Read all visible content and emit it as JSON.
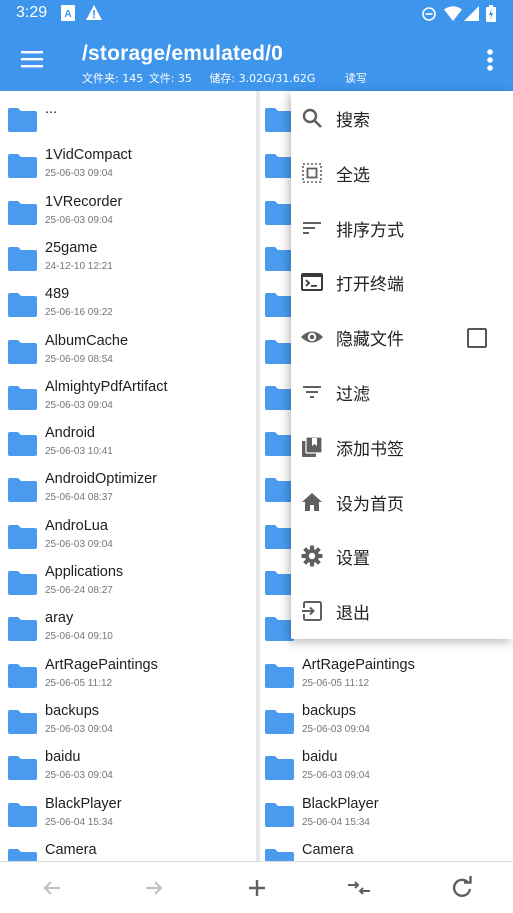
{
  "colors": {
    "primary": "#3d95ec",
    "folder": "#4a9bf0",
    "icon_gray": "#5f5f5f"
  },
  "status_bar": {
    "time": "3:29"
  },
  "toolbar": {
    "title": "/storage/emulated/0",
    "folders": "文件夹: 145",
    "files": "文件: 35",
    "storage": "储存: 3.02G/31.62G",
    "mode": "读写",
    "menu_icon": "hamburger-icon",
    "overflow_icon": "more-vert-icon"
  },
  "left_pane": [
    {
      "name": "...",
      "date": ""
    },
    {
      "name": "1VidCompact",
      "date": "25-06-03 09:04"
    },
    {
      "name": "1VRecorder",
      "date": "25-06-03 09:04"
    },
    {
      "name": "25game",
      "date": "24-12-10 12:21"
    },
    {
      "name": "489",
      "date": "25-06-16 09:22"
    },
    {
      "name": "AlbumCache",
      "date": "25-06-09 08:54"
    },
    {
      "name": "AlmightyPdfArtifact",
      "date": "25-06-03 09:04"
    },
    {
      "name": "Android",
      "date": "25-06-03 10:41"
    },
    {
      "name": "AndroidOptimizer",
      "date": "25-06-04 08:37"
    },
    {
      "name": "AndroLua",
      "date": "25-06-03 09:04"
    },
    {
      "name": "Applications",
      "date": "25-06-24 08:27"
    },
    {
      "name": "aray",
      "date": "25-06-04 09:10"
    },
    {
      "name": "ArtRagePaintings",
      "date": "25-06-05 11:12"
    },
    {
      "name": "backups",
      "date": "25-06-03 09:04"
    },
    {
      "name": "baidu",
      "date": "25-06-03 09:04"
    },
    {
      "name": "BlackPlayer",
      "date": "25-06-04 15:34"
    },
    {
      "name": "Camera",
      "date": ""
    }
  ],
  "right_pane": [
    {
      "name": "ArtRagePaintings",
      "date": "25-06-05 11:12"
    },
    {
      "name": "backups",
      "date": "25-06-03 09:04"
    },
    {
      "name": "baidu",
      "date": "25-06-03 09:04"
    },
    {
      "name": "BlackPlayer",
      "date": "25-06-04 15:34"
    },
    {
      "name": "Camera",
      "date": ""
    }
  ],
  "menu": [
    {
      "label": "搜索",
      "icon": "search-icon"
    },
    {
      "label": "全选",
      "icon": "select-all-icon"
    },
    {
      "label": "排序方式",
      "icon": "sort-icon"
    },
    {
      "label": "打开终端",
      "icon": "terminal-icon"
    },
    {
      "label": "隐藏文件",
      "icon": "eye-icon",
      "checked": false
    },
    {
      "label": "过滤",
      "icon": "filter-icon"
    },
    {
      "label": "添加书签",
      "icon": "bookmark-icon"
    },
    {
      "label": "设为首页",
      "icon": "home-icon"
    },
    {
      "label": "设置",
      "icon": "gear-icon"
    },
    {
      "label": "退出",
      "icon": "exit-icon"
    }
  ],
  "bottom_bar": [
    "back-arrow-icon",
    "forward-arrow-icon",
    "add-icon",
    "swap-icon",
    "refresh-icon"
  ]
}
